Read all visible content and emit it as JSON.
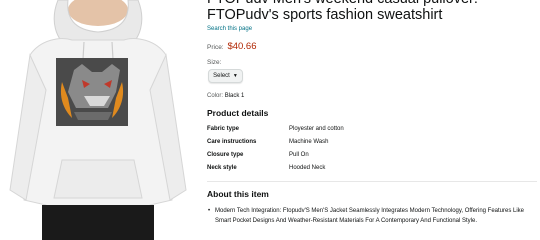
{
  "product": {
    "title": "FTOPudv Men's weekend casual pullover: FTOPudv's sports fashion sweatshirt",
    "search_link": "Search this page",
    "price_label": "Price:",
    "price": "$40.66",
    "size_label": "Size:",
    "size_select": "Select",
    "color_label": "Color:",
    "color_value": "Black 1"
  },
  "details": {
    "heading": "Product details",
    "rows": [
      {
        "key": "Fabric type",
        "value": "Ployester and cotton"
      },
      {
        "key": "Care instructions",
        "value": "Machine Wash"
      },
      {
        "key": "Closure type",
        "value": "Pull On"
      },
      {
        "key": "Neck style",
        "value": "Hooded Neck"
      }
    ]
  },
  "about": {
    "heading": "About this item",
    "bullets": [
      "Modern Tech Integration: Ftopudv'S Men'S Jacket Seamlessly Integrates Modern Technology, Offering Features Like Smart Pocket Designs And Weather-Resistant Materials For A Contemporary And Functional Style."
    ]
  },
  "colors": {
    "price": "#b12704",
    "link": "#007185"
  }
}
